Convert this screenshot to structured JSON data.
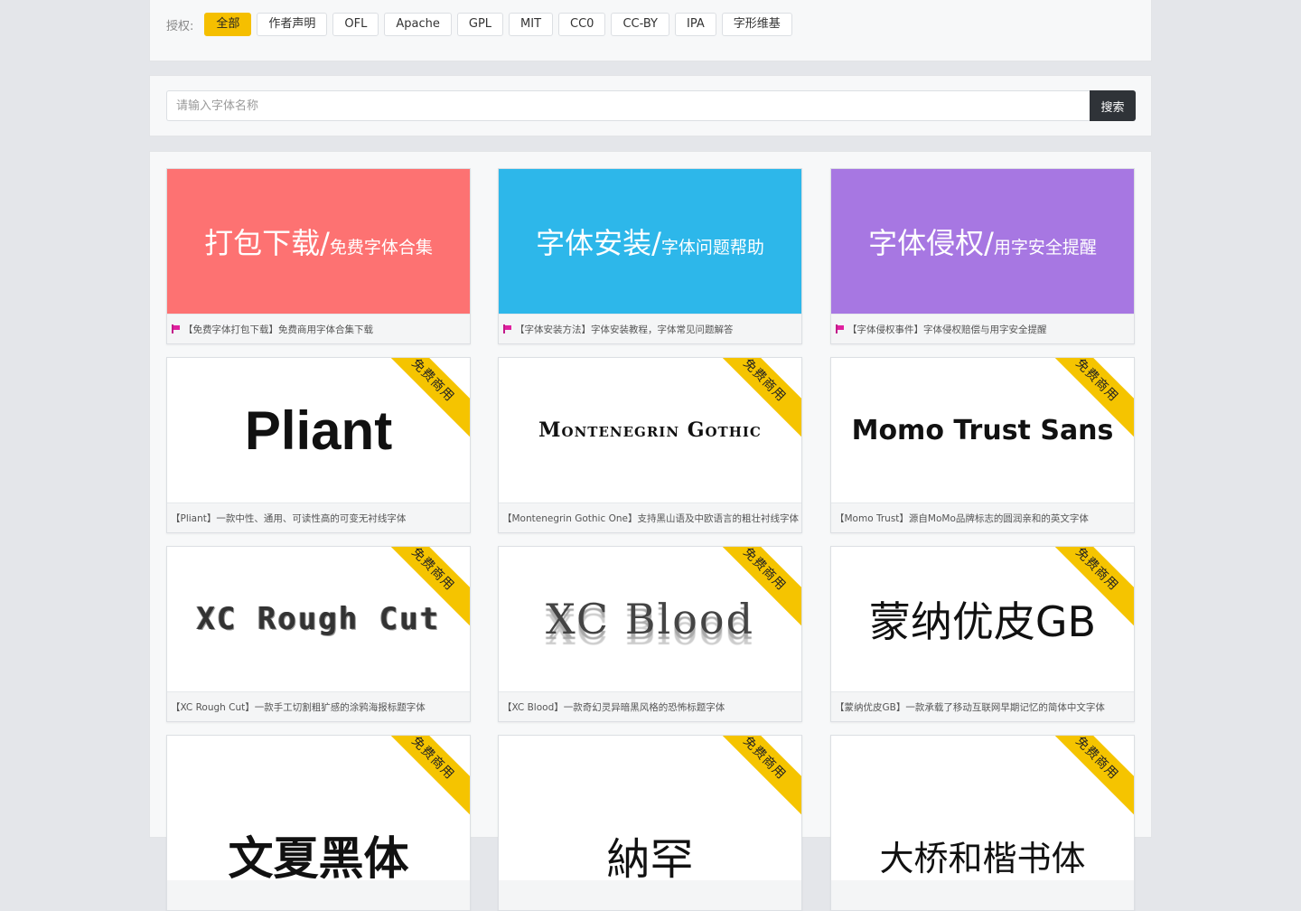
{
  "filter": {
    "label": "授权:",
    "tags": [
      "全部",
      "作者声明",
      "OFL",
      "Apache",
      "GPL",
      "MIT",
      "CC0",
      "CC-BY",
      "IPA",
      "字形维基"
    ],
    "active_index": 0,
    "accent_color": "#f5bf00"
  },
  "search": {
    "placeholder": "请输入字体名称",
    "button_label": "搜索"
  },
  "promos": [
    {
      "main": "打包下载/",
      "sub": "免费字体合集",
      "caption": "【免费字体打包下载】免费商用字体合集下载",
      "color": "#fd7272"
    },
    {
      "main": "字体安装/",
      "sub": "字体问题帮助",
      "caption": "【字体安装方法】字体安装教程，字体常见问题解答",
      "color": "#2db7ea"
    },
    {
      "main": "字体侵权/",
      "sub": "用字安全提醒",
      "caption": "【字体侵权事件】字体侵权赔偿与用字安全提醒",
      "color": "#a777e2"
    }
  ],
  "fonts": [
    {
      "sample": "Pliant",
      "caption": "【Pliant】一款中性、通用、可读性高的可变无衬线字体",
      "badge": "免费商用"
    },
    {
      "sample": "Montenegrin Gothic",
      "caption": "【Montenegrin Gothic One】支持黑山语及中欧语言的粗壮衬线字体",
      "badge": "免费商用"
    },
    {
      "sample": "Momo Trust Sans",
      "caption": "【Momo Trust】源自MoMo品牌标志的圆润亲和的英文字体",
      "badge": "免费商用"
    },
    {
      "sample": "XC Rough Cut",
      "caption": "【XC Rough Cut】一款手工切割粗犷感的涂鸦海报标题字体",
      "badge": "免费商用"
    },
    {
      "sample": "XC Blood",
      "caption": "【XC Blood】一款奇幻灵异暗黑风格的恐怖标题字体",
      "badge": "免费商用"
    },
    {
      "sample": "蒙纳优皮GB",
      "caption": "【蒙纳优皮GB】一款承载了移动互联网早期记忆的简体中文字体",
      "badge": "免费商用"
    },
    {
      "sample": "文夏黑体",
      "caption": "",
      "badge": "免费商用"
    },
    {
      "sample": "納罕",
      "caption": "",
      "badge": "免费商用"
    },
    {
      "sample": "大桥和楷书体",
      "caption": "",
      "badge": "免费商用"
    }
  ]
}
